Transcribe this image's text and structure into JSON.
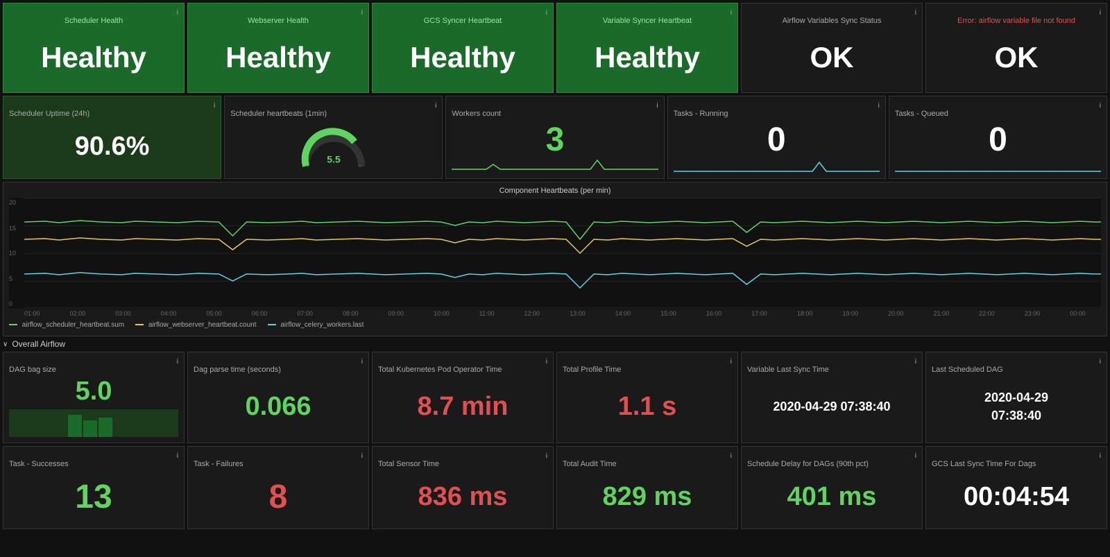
{
  "topRow": {
    "cards": [
      {
        "id": "scheduler-health",
        "title": "Scheduler Health",
        "value": "Healthy",
        "type": "green"
      },
      {
        "id": "webserver-health",
        "title": "Webserver Health",
        "value": "Healthy",
        "type": "green"
      },
      {
        "id": "gcs-syncer",
        "title": "GCS Syncer Heartbeat",
        "value": "Healthy",
        "type": "green"
      },
      {
        "id": "variable-syncer",
        "title": "Variable Syncer Heartbeat",
        "value": "Healthy",
        "type": "green"
      },
      {
        "id": "airflow-vars-sync",
        "title": "Airflow Variables Sync Status",
        "value": "OK",
        "type": "dark"
      },
      {
        "id": "error-airflow",
        "title": "Error: airflow variable file not found",
        "value": "OK",
        "type": "dark"
      }
    ]
  },
  "metricsRow": {
    "cards": [
      {
        "id": "scheduler-uptime",
        "title": "Scheduler Uptime (24h)",
        "value": "90.6%",
        "type": "uptime"
      },
      {
        "id": "scheduler-heartbeats",
        "title": "Scheduler heartbeats (1min)",
        "value": "5.5",
        "type": "gauge"
      },
      {
        "id": "workers-count",
        "title": "Workers count",
        "value": "3",
        "type": "numeric-green"
      },
      {
        "id": "tasks-running",
        "title": "Tasks - Running",
        "value": "0",
        "type": "numeric-white"
      },
      {
        "id": "tasks-queued",
        "title": "Tasks - Queued",
        "value": "0",
        "type": "numeric-white"
      }
    ]
  },
  "chart": {
    "title": "Component Heartbeats (per min)",
    "yLabels": [
      "20",
      "15",
      "10",
      "5",
      "0"
    ],
    "xLabels": [
      "01:00",
      "02:00",
      "03:00",
      "04:00",
      "05:00",
      "06:00",
      "07:00",
      "08:00",
      "09:00",
      "10:00",
      "11:00",
      "12:00",
      "13:00",
      "14:00",
      "15:00",
      "16:00",
      "17:00",
      "18:00",
      "19:00",
      "20:00",
      "21:00",
      "22:00",
      "23:00",
      "00:00"
    ],
    "legend": [
      {
        "label": "airflow_scheduler_heartbeat.sum",
        "color": "#5fd45f"
      },
      {
        "label": "airflow_webserver_heartbeat.count",
        "color": "#e8c85a"
      },
      {
        "label": "airflow_celery_workers.last",
        "color": "#5ad4e8"
      }
    ]
  },
  "sectionHeader": {
    "label": "Overall Airflow",
    "chevron": "∨"
  },
  "overallRow1": {
    "cards": [
      {
        "id": "dag-bag-size",
        "title": "DAG bag size",
        "value": "5.0",
        "valueType": "green",
        "hasBar": true
      },
      {
        "id": "dag-parse-time",
        "title": "Dag parse time (seconds)",
        "value": "0.066",
        "valueType": "green"
      },
      {
        "id": "total-k8s-pod",
        "title": "Total Kubernetes Pod Operator Time",
        "value": "8.7 min",
        "valueType": "red"
      },
      {
        "id": "total-profile-time",
        "title": "Total Profile Time",
        "value": "1.1 s",
        "valueType": "red"
      },
      {
        "id": "variable-last-sync",
        "title": "Variable Last Sync Time",
        "value": "2020-04-29 07:38:40",
        "valueType": "white"
      },
      {
        "id": "last-scheduled-dag",
        "title": "Last Scheduled DAG",
        "value": "2020-04-29\n07:38:40",
        "valueType": "white"
      }
    ]
  },
  "overallRow2": {
    "cards": [
      {
        "id": "task-successes",
        "title": "Task - Successes",
        "value": "13",
        "valueType": "green"
      },
      {
        "id": "task-failures",
        "title": "Task - Failures",
        "value": "8",
        "valueType": "red"
      },
      {
        "id": "total-sensor-time",
        "title": "Total Sensor Time",
        "value": "836 ms",
        "valueType": "red"
      },
      {
        "id": "total-audit-time",
        "title": "Total Audit Time",
        "value": "829 ms",
        "valueType": "green"
      },
      {
        "id": "schedule-delay",
        "title": "Schedule Delay for DAGs (90th pct)",
        "value": "401 ms",
        "valueType": "green"
      },
      {
        "id": "gcs-last-sync",
        "title": "GCS Last Sync Time For Dags",
        "value": "00:04:54",
        "valueType": "white"
      }
    ]
  },
  "colors": {
    "green": "#5fd45f",
    "red": "#e05050",
    "white": "#ffffff",
    "darkBg": "#1a1a1a",
    "greenBg": "#1a6b2a"
  }
}
